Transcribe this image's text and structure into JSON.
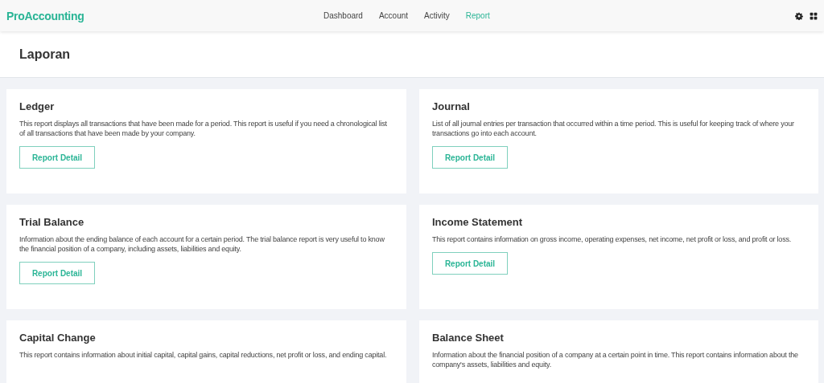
{
  "brand": "ProAccounting",
  "nav": [
    {
      "label": "Dashboard",
      "selected": false
    },
    {
      "label": "Account",
      "selected": false
    },
    {
      "label": "Activity",
      "selected": false
    },
    {
      "label": "Report",
      "selected": true
    }
  ],
  "page_title": "Laporan",
  "reports": [
    {
      "title": "Ledger",
      "description": "This report displays all transactions that have been made for a period. This report is useful if you need a chronological list of all transactions that have been made by your company.",
      "button": "Report Detail"
    },
    {
      "title": "Journal",
      "description": "List of all journal entries per transaction that occurred within a time period. This is useful for keeping track of where your transactions go into each account.",
      "button": "Report Detail"
    },
    {
      "title": "Trial Balance",
      "description": "Information about the ending balance of each account for a certain period. The trial balance report is very useful to know the financial position of a company, including assets, liabilities and equity.",
      "button": "Report Detail"
    },
    {
      "title": "Income Statement",
      "description": "This report contains information on gross income, operating expenses, net income, net profit or loss, and profit or loss.",
      "button": "Report Detail"
    },
    {
      "title": "Capital Change",
      "description": "This report contains information about initial capital, capital gains, capital reductions, net profit or loss, and ending capital."
    },
    {
      "title": "Balance Sheet",
      "description": "Information about the financial position of a company at a certain point in time. This report contains information about the company's assets, liabilities and equity."
    }
  ]
}
